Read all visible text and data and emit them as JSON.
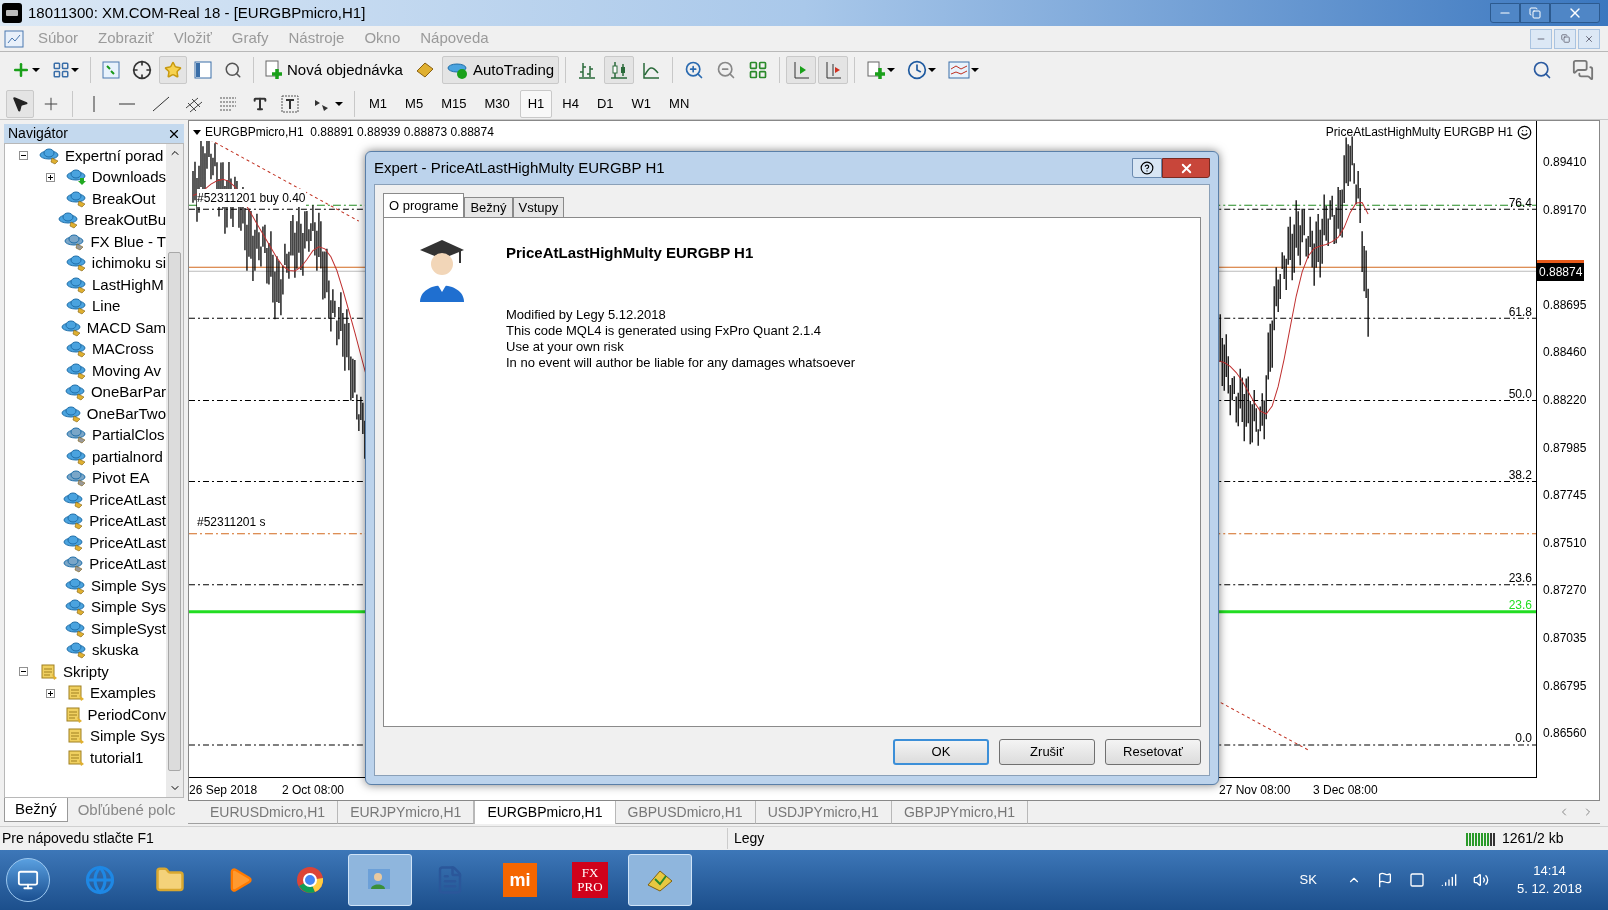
{
  "window": {
    "title": "18011300: XM.COM-Real 18 - [EURGBPmicro,H1]"
  },
  "menu": {
    "disabled": true,
    "items": [
      "Súbor",
      "Zobraziť",
      "Vložiť",
      "Grafy",
      "Nástroje",
      "Okno",
      "Nápoveda"
    ]
  },
  "toolbar": {
    "new_order": "Nová objednávka",
    "autotrading": {
      "label": "AutoTrading",
      "on": true
    },
    "chart_type": {
      "bars": false,
      "candles": true,
      "line": false
    },
    "auto_scroll": true,
    "chart_shift": true
  },
  "periods": [
    {
      "label": "M1",
      "selected": false
    },
    {
      "label": "M5",
      "selected": false
    },
    {
      "label": "M15",
      "selected": false
    },
    {
      "label": "M30",
      "selected": false
    },
    {
      "label": "H1",
      "selected": true
    },
    {
      "label": "H4",
      "selected": false
    },
    {
      "label": "D1",
      "selected": false
    },
    {
      "label": "W1",
      "selected": false
    },
    {
      "label": "MN",
      "selected": false
    }
  ],
  "navigator": {
    "title": "Navigátor",
    "tree": [
      {
        "label": "Expertní porad",
        "kind": "experts",
        "expanded": true,
        "children": [
          {
            "label": "Downloads",
            "kind": "download",
            "expanded": false
          },
          {
            "label": "BreakOut",
            "kind": "expert"
          },
          {
            "label": "BreakOutBu",
            "kind": "expert"
          },
          {
            "label": "FX Blue - T",
            "kind": "expert_grey"
          },
          {
            "label": "ichimoku si",
            "kind": "expert"
          },
          {
            "label": "LastHighM",
            "kind": "expert"
          },
          {
            "label": "Line",
            "kind": "expert"
          },
          {
            "label": "MACD Sam",
            "kind": "expert"
          },
          {
            "label": "MACross",
            "kind": "expert"
          },
          {
            "label": "Moving Av",
            "kind": "expert"
          },
          {
            "label": "OneBarPar",
            "kind": "expert"
          },
          {
            "label": "OneBarTwo",
            "kind": "expert"
          },
          {
            "label": "PartialClos",
            "kind": "expert_grey"
          },
          {
            "label": "partialnord",
            "kind": "expert"
          },
          {
            "label": "Pivot EA",
            "kind": "expert_grey"
          },
          {
            "label": "PriceAtLast",
            "kind": "expert"
          },
          {
            "label": "PriceAtLast",
            "kind": "expert"
          },
          {
            "label": "PriceAtLast",
            "kind": "expert"
          },
          {
            "label": "PriceAtLast",
            "kind": "expert_grey"
          },
          {
            "label": "Simple Sys",
            "kind": "expert"
          },
          {
            "label": "Simple Sys",
            "kind": "expert"
          },
          {
            "label": "SimpleSyst",
            "kind": "expert"
          },
          {
            "label": "skuska",
            "kind": "expert"
          }
        ]
      },
      {
        "label": "Skripty",
        "kind": "script",
        "expanded": true,
        "children": [
          {
            "label": "Examples",
            "kind": "script",
            "expanded": false
          },
          {
            "label": "PeriodConv",
            "kind": "script"
          },
          {
            "label": "Simple Sys",
            "kind": "script"
          },
          {
            "label": "tutorial1",
            "kind": "script"
          }
        ]
      }
    ],
    "tabs": [
      {
        "label": "Bežný",
        "selected": true
      },
      {
        "label": "Obľúbené polc",
        "selected": false
      }
    ]
  },
  "chart": {
    "header": "EURGBPmicro,H1  0.88891 0.88939 0.88873 0.88874",
    "expert_label": "PriceAtLastHighMulty EURGBP H1",
    "order_labels": [
      "#52311201 buy 0.40",
      "#52311201 s"
    ],
    "fib_levels": [
      {
        "label": "76.4",
        "color": "#000000"
      },
      {
        "label": "61.8",
        "color": "#000000"
      },
      {
        "label": "50.0",
        "color": "#000000"
      },
      {
        "label": "38.2",
        "color": "#000000"
      },
      {
        "label": "23.6",
        "color": "#000000"
      },
      {
        "label": "23.6",
        "color": "#22dd22"
      },
      {
        "label": "0.0",
        "color": "#000000"
      }
    ],
    "price_labels": [
      "0.89410",
      "0.89170",
      "0.88695",
      "0.88460",
      "0.88220",
      "0.87985",
      "0.87745",
      "0.87510",
      "0.87270",
      "0.87035",
      "0.86795",
      "0.86560"
    ],
    "current_price": "0.88874",
    "time_labels": [
      "26 Sep 2018",
      "2 Oct 08:00",
      "27 Nov 08:00",
      "3 Dec 08:00"
    ]
  },
  "chart_tabs": [
    {
      "label": "EURUSDmicro,H1",
      "selected": false
    },
    {
      "label": "EURJPYmicro,H1",
      "selected": false
    },
    {
      "label": "EURGBPmicro,H1",
      "selected": true
    },
    {
      "label": "GBPUSDmicro,H1",
      "selected": false
    },
    {
      "label": "USDJPYmicro,H1",
      "selected": false
    },
    {
      "label": "GBPJPYmicro,H1",
      "selected": false
    }
  ],
  "dialog": {
    "title": "Expert - PriceAtLastHighMulty EURGBP H1",
    "tabs": [
      {
        "label": "O programe",
        "selected": true
      },
      {
        "label": "Bežný",
        "selected": false
      },
      {
        "label": "Vstupy",
        "selected": false
      }
    ],
    "heading": "PriceAtLastHighMulty EURGBP H1",
    "lines": [
      "Modified by Legy 5.12.2018",
      "This code MQL4 is generated using FxPro Quant 2.1.4",
      "Use at your own risk",
      "In no event will author be liable for any damages whatsoever"
    ],
    "buttons": [
      {
        "label": "OK",
        "default": true
      },
      {
        "label": "Zrušiť",
        "default": false
      },
      {
        "label": "Resetovať",
        "default": false
      }
    ]
  },
  "status_bar": {
    "help": "Pre nápovedu stlačte F1",
    "profile": "Legy",
    "traffic": "1261/2 kb"
  },
  "taskbar": {
    "apps": [
      {
        "kind": "ie",
        "active": false
      },
      {
        "kind": "explorer",
        "active": false
      },
      {
        "kind": "media",
        "active": false
      },
      {
        "kind": "chrome",
        "active": false
      },
      {
        "kind": "contacts",
        "active": true
      },
      {
        "kind": "word",
        "active": false
      },
      {
        "kind": "mi",
        "label": "mi",
        "active": false
      },
      {
        "kind": "fxpro",
        "label": "FX PRO",
        "active": false
      },
      {
        "kind": "mt4",
        "active": true
      }
    ],
    "language": "SK",
    "time": "14:14",
    "date": "5. 12. 2018"
  }
}
